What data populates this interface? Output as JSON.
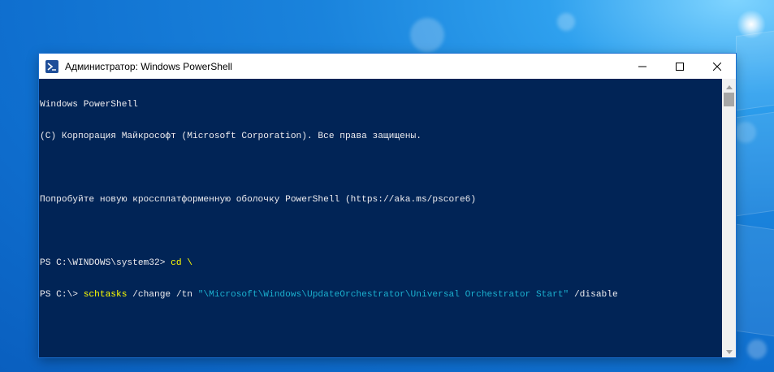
{
  "window": {
    "title": "Администратор: Windows PowerShell",
    "icon": "powershell-icon",
    "controls": {
      "minimize_icon": "minimize-icon",
      "maximize_icon": "maximize-icon",
      "close_icon": "close-icon"
    }
  },
  "console": {
    "lines": [
      "Windows PowerShell",
      "(C) Корпорация Майкрософт (Microsoft Corporation). Все права защищены.",
      "",
      "Попробуйте новую кроссплатформенную оболочку PowerShell (https://aka.ms/pscore6)",
      ""
    ],
    "cmd1": {
      "prompt": "PS C:\\WINDOWS\\system32> ",
      "command": "cd \\"
    },
    "cmd2": {
      "prompt": "PS C:\\> ",
      "command": "schtasks",
      "args1": " /change /tn ",
      "string": "\"\\Microsoft\\Windows\\UpdateOrchestrator\\Universal Orchestrator Start\"",
      "args2": " /disable"
    }
  },
  "colors": {
    "console_background": "#012456",
    "console_text": "#eeedf0",
    "command_color": "#ffff00",
    "string_color": "#1bb0cf",
    "desktop_blue": "#1a83dc"
  }
}
